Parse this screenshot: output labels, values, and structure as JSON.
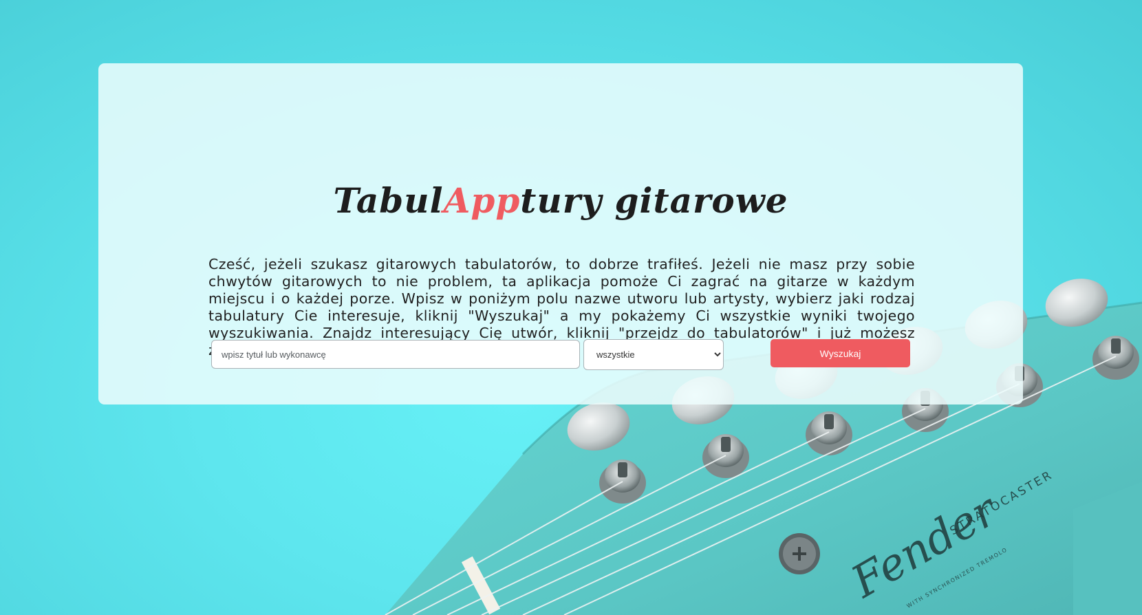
{
  "app": {
    "title_part1": "Tabul",
    "title_accent": "App",
    "title_part2": "tury gitarowe"
  },
  "intro": {
    "text": "Cześć, jeżeli szukasz gitarowych tabulatorów, to dobrze trafiłeś. Jeżeli nie masz przy sobie chwytów gitarowych to nie problem, ta aplikacja pomoże Ci zagrać na gitarze w każdym miejscu i o każdej porze. Wpisz w poniżym polu nazwe utworu lub artysty, wybierz jaki rodzaj tabulatury Cie interesuje, kliknij \"Wyszukaj\" a my pokażemy Ci wszystkie wyniki twojego wyszukiwania. Znajdz interesujący Cię utwór, kliknij \"przejdz do tabulatorów\" i już możesz zaczynać grać !!"
  },
  "search": {
    "placeholder": "wpisz tytuł lub wykonawcę",
    "value": "",
    "type_selected": "wszystkie",
    "button_label": "Wyszukaj"
  },
  "background": {
    "brand_text": "Fender",
    "model_text": "STRATOCASTER",
    "tremolo_text": "WITH SYNCHRONIZED TREMOLO"
  },
  "colors": {
    "accent": "#ef5b60",
    "background": "#5ee6ee",
    "headstock": "#5fcac8",
    "card": "#edfdfd"
  }
}
